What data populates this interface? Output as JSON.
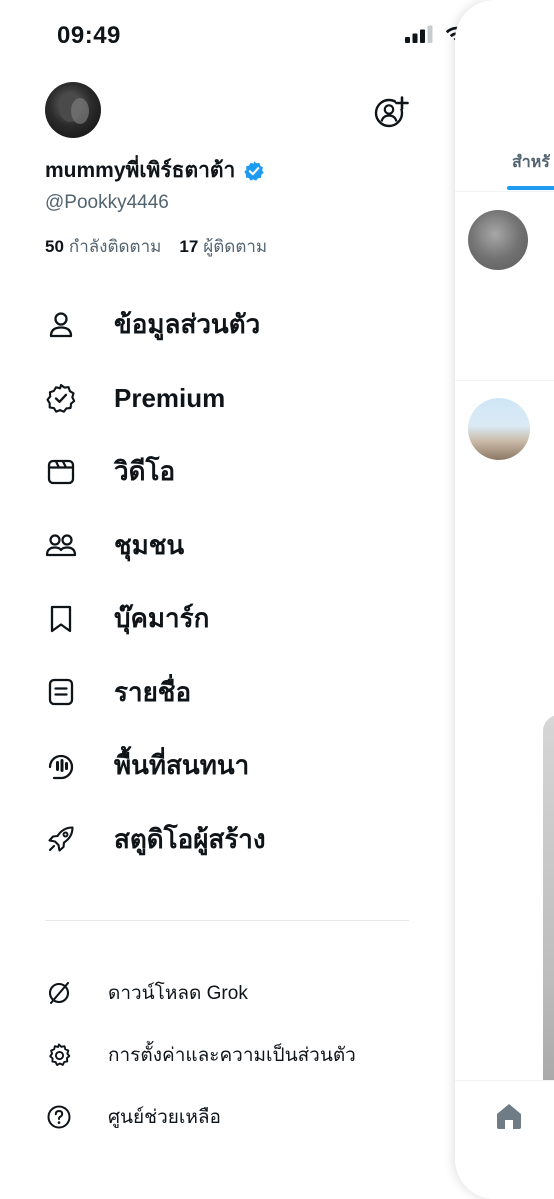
{
  "status_bar": {
    "time": "09:49",
    "icons": [
      "signal-icon",
      "wifi-icon",
      "battery-icon"
    ]
  },
  "profile": {
    "display_name": "mummyพี่เพิร์ธตาต้า",
    "handle": "@Pookky4446",
    "following_count": "50",
    "following_label": "กำลังติดตาม",
    "followers_count": "17",
    "followers_label": "ผู้ติดตาม",
    "verified_color": "#1d9bf0"
  },
  "menu": [
    {
      "label": "ข้อมูลส่วนตัว",
      "icon": "person-icon"
    },
    {
      "label": "Premium",
      "icon": "verified-badge-icon"
    },
    {
      "label": "วิดีโอ",
      "icon": "video-icon"
    },
    {
      "label": "ชุมชน",
      "icon": "communities-icon"
    },
    {
      "label": "บุ๊คมาร์ก",
      "icon": "bookmark-icon"
    },
    {
      "label": "รายชื่อ",
      "icon": "lists-icon"
    },
    {
      "label": "พื้นที่สนทนา",
      "icon": "spaces-icon"
    },
    {
      "label": "สตูดิโอผู้สร้าง",
      "icon": "rocket-icon"
    }
  ],
  "bottom_menu": [
    {
      "label": "ดาวน์โหลด Grok",
      "icon": "grok-icon"
    },
    {
      "label": "การตั้งค่าและความเป็นส่วนตัว",
      "icon": "settings-icon"
    },
    {
      "label": "ศูนย์ช่วยเหลือ",
      "icon": "help-icon"
    }
  ],
  "timeline": {
    "tab_label": "สำหรั",
    "accent": "#1d9bf0"
  }
}
